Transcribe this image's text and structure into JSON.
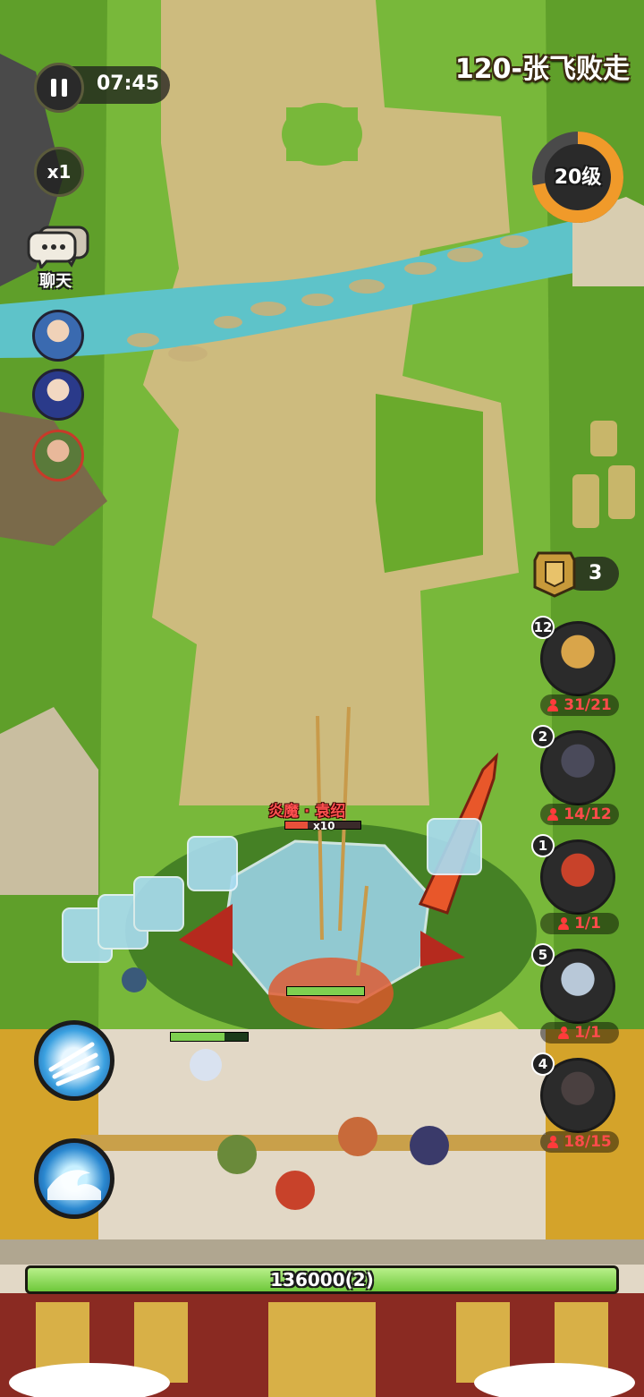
{
  "hud": {
    "timer": "07:45",
    "speed": "x1",
    "chat_label": "聊天",
    "stage_title": "120-张飞败走",
    "level_label": "20级",
    "level_progress": 0.72,
    "token_count": "3"
  },
  "boss": {
    "name": "炎魔 · 袁绍",
    "multiplier": "x10",
    "health_fraction": 0.3
  },
  "units": [
    {
      "level": "12",
      "count": "31/21"
    },
    {
      "level": "2",
      "count": "14/12"
    },
    {
      "level": "1",
      "count": "1/1"
    },
    {
      "level": "5",
      "count": "1/1"
    },
    {
      "level": "4",
      "count": "18/15"
    }
  ],
  "base": {
    "hp_text": "136000(2)",
    "hp_fraction": 1.0
  },
  "colors": {
    "grass": "#6aaa2c",
    "path": "#c9b77a",
    "river": "#5ec3c9",
    "level_ring": "#f09a2a",
    "hp_bar": "#8fe05a",
    "count_red": "#ff4b4b"
  },
  "icons": {
    "pause": "pause-icon",
    "chat": "chat-bubble-icon",
    "token": "command-token-icon",
    "skill1": "ice-spikes-skill-icon",
    "skill2": "wave-skill-icon"
  }
}
